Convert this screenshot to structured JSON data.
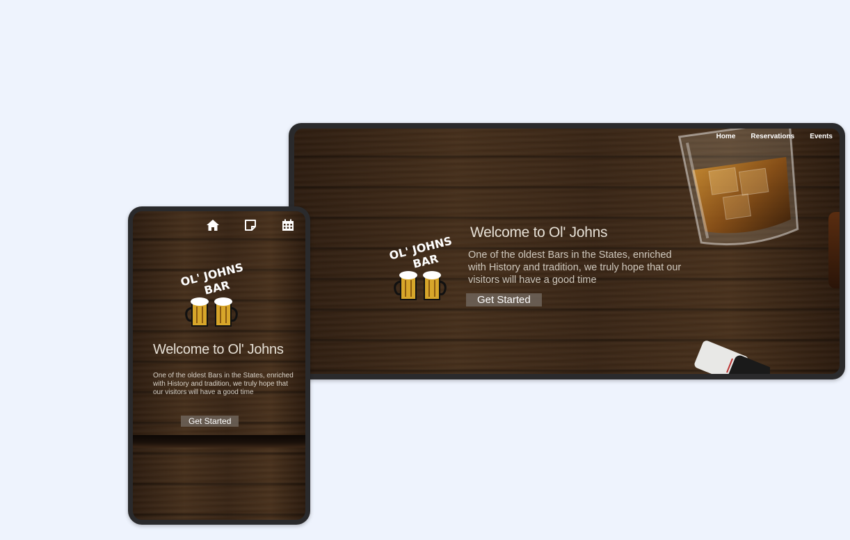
{
  "desktop": {
    "nav": {
      "home": "Home",
      "reservations": "Reservations",
      "events": "Events"
    },
    "logo": {
      "line1": "OL' JOHNS",
      "line2": "BAR"
    },
    "hero": {
      "title": "Welcome to Ol' Johns",
      "description": "One of the oldest Bars in the States, enriched with History and tradition, we truly hope that our visitors will have a good time",
      "cta": "Get Started"
    }
  },
  "mobile": {
    "nav_icons": [
      "home-icon",
      "note-icon",
      "calendar-icon"
    ],
    "logo": {
      "line1": "OL' JOHNS",
      "line2": "BAR"
    },
    "hero": {
      "title": "Welcome to Ol' Johns",
      "description": "One of the oldest Bars in the States, enriched with History and tradition, we truly hope that our visitors will have a good time",
      "cta": "Get Started"
    }
  },
  "colors": {
    "page_background": "#eef3fd",
    "device_bezel": "#2a2a2c",
    "wood_dark": "#2e1d10",
    "wood_light": "#4a321d",
    "button_bg": "#6e645a"
  }
}
